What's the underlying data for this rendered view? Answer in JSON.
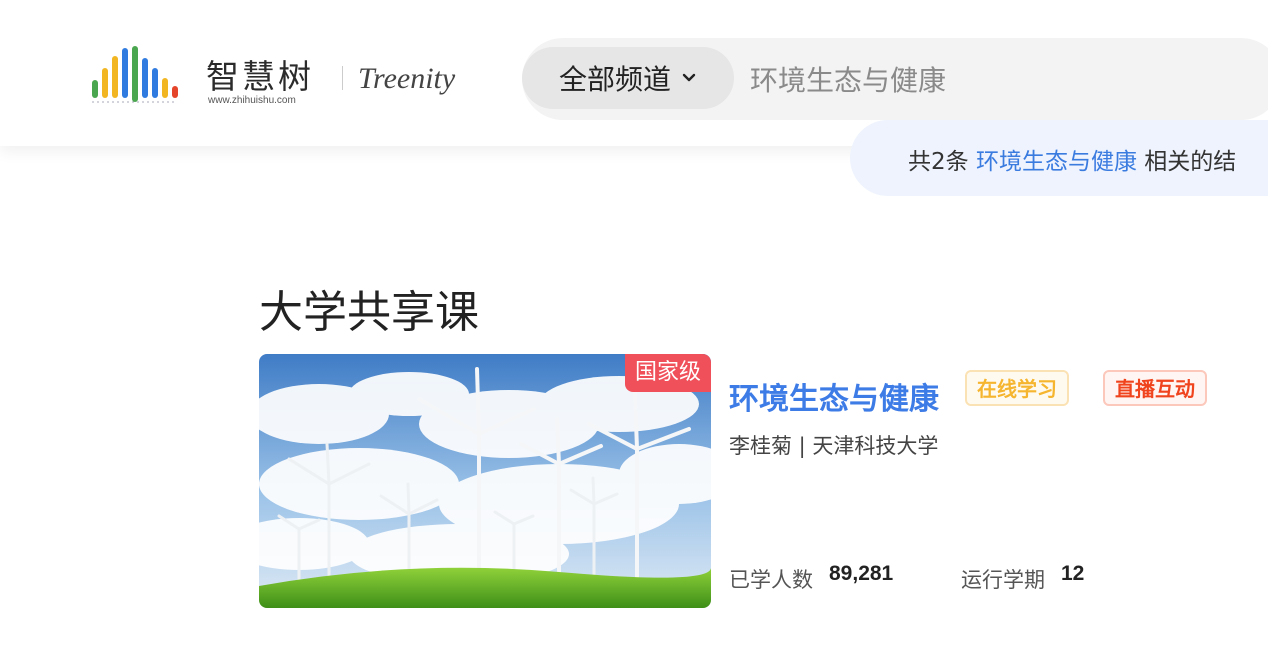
{
  "header": {
    "logo_cn": "智慧树",
    "logo_url": "www.zhihuishu.com",
    "logo_en": "Treenity",
    "channel_label": "全部频道",
    "search_value": "环境生态与健康"
  },
  "results": {
    "prefix": "共2条",
    "keyword": "环境生态与健康",
    "suffix": "相关的结"
  },
  "section": {
    "title": "大学共享课"
  },
  "course": {
    "badge": "国家级",
    "title": "环境生态与健康",
    "tag_online": "在线学习",
    "tag_live": "直播互动",
    "teacher": "李桂菊 | 天津科技大学",
    "learners_label": "已学人数",
    "learners_value": "89,281",
    "terms_label": "运行学期",
    "terms_value": "12"
  },
  "colors": {
    "accent_blue": "#3d7be6",
    "badge_red": "#f0505a",
    "tag_online": "#f5b52e",
    "tag_live": "#f0441e"
  },
  "icons": {
    "chevron": "chevron-down-icon",
    "logo": "zhihuishu-logo-bars"
  }
}
